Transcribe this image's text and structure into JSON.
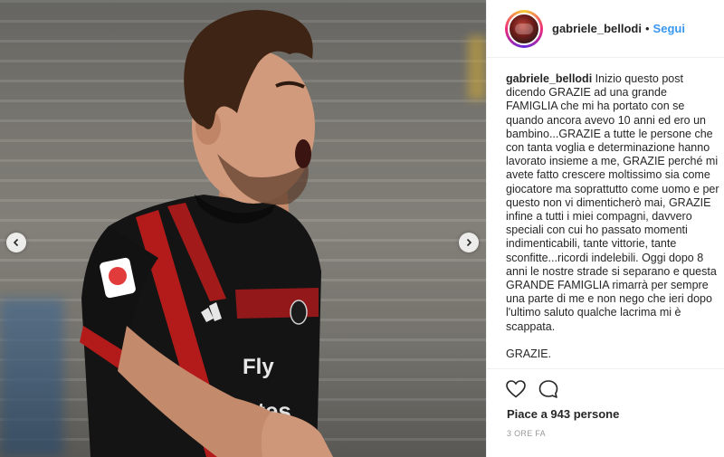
{
  "post": {
    "image_alt": "Photo of a football player in a red and black striped jersey shouting and pointing",
    "prev_icon": "chevron-left-icon",
    "next_icon": "chevron-right-icon"
  },
  "header": {
    "username": "gabriele_bellodi",
    "separator": "•",
    "follow_label": "Segui"
  },
  "caption": {
    "username": "gabriele_bellodi",
    "text": "Inizio questo post dicendo GRAZIE ad una grande FAMIGLIA che mi ha portato con se quando ancora avevo 10 anni ed ero un bambino...GRAZIE a tutte le persone che con tanta voglia e determinazione hanno lavorato insieme a me, GRAZIE perché mi avete fatto crescere moltissimo sia come giocatore ma soprattutto come uomo e per questo non vi dimenticherò mai, GRAZIE infine a tutti i miei compagni, davvero speciali con cui ho passato momenti indimenticabili, tante vittorie, tante sconfitte...ricordi indelebili. Oggi dopo 8 anni le nostre strade si separano e questa GRANDE FAMIGLIA rimarrà per sempre una parte di me e non nego che ieri dopo l'ultimo saluto qualche lacrima mi è scappata.",
    "closing": "GRAZIE."
  },
  "actions": {
    "like_icon": "heart-icon",
    "comment_icon": "comment-icon",
    "likes_text": "Piace a 943 persone",
    "timestamp": "3 ORE FA"
  },
  "jersey": {
    "sponsor": "Fly",
    "sponsor2": "Emirates"
  }
}
